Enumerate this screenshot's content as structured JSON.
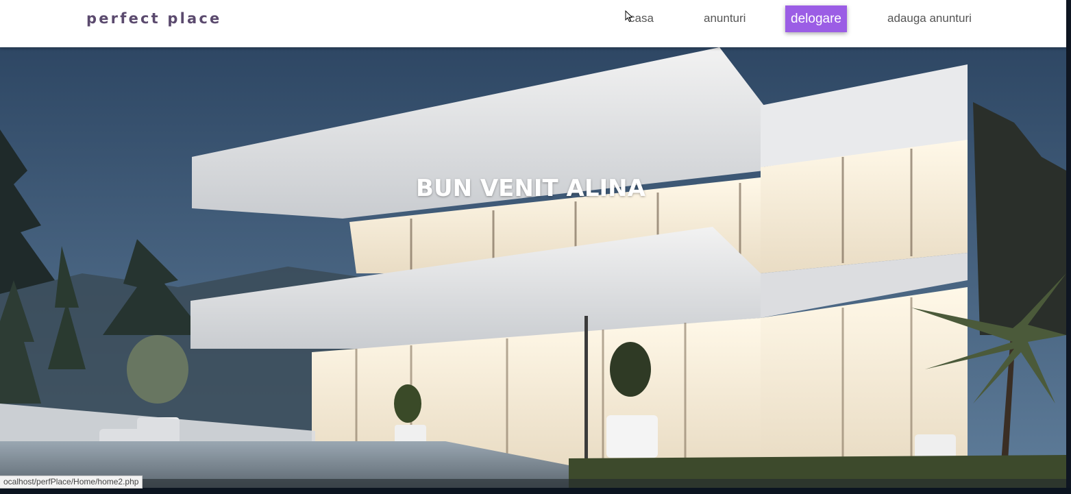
{
  "navbar": {
    "brand": "perfect place",
    "links": [
      {
        "label": "casa"
      },
      {
        "label": "anunturi"
      },
      {
        "label": "delogare",
        "active": true
      },
      {
        "label": "adauga anunturi"
      }
    ]
  },
  "hero": {
    "title": "BUN VENIT ALINA"
  },
  "status_bar": {
    "url": "ocalhost/perfPlace/Home/home2.php"
  },
  "colors": {
    "accent": "#9b5de5",
    "brand_text": "#5b4a6e",
    "nav_text": "#555555"
  },
  "icons": {
    "cursor": "mouse-pointer-icon"
  }
}
